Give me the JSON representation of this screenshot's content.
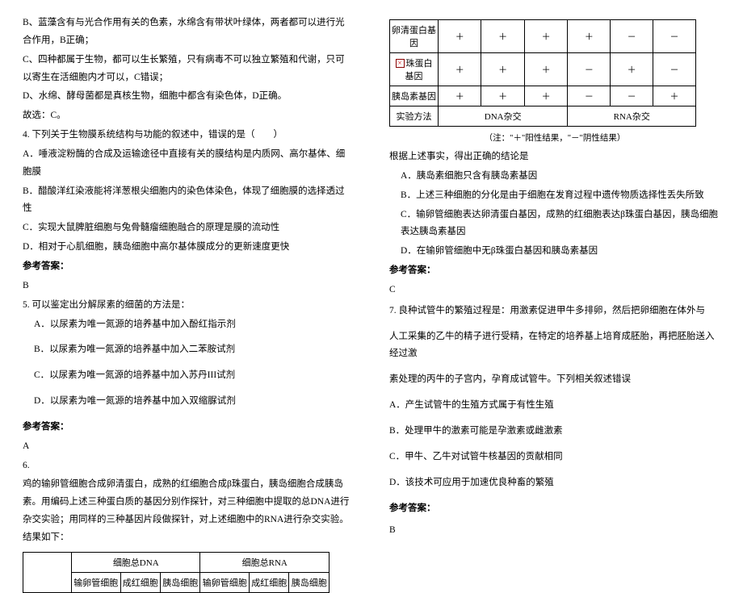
{
  "col1": {
    "p1": "B、蓝藻含有与光合作用有关的色素，水绵含有带状叶绿体，两者都可以进行光合作用，B正确；",
    "p2": "C、四种都属于生物，都可以生长繁殖，只有病毒不可以独立繁殖和代谢，只可以寄生在活细胞内才可以，C错误；",
    "p3": "D、水绵、酵母菌都是真核生物，细胞中都含有染色体，D正确。",
    "p4": "故选：C。",
    "q4": "4. 下列关于生物膜系统结构与功能的叙述中，错误的是（　　）",
    "q4a": "A．唾液淀粉酶的合成及运输途径中直接有关的膜结构是内质网、高尔基体、细胞膜",
    "q4b": "B．醋酸洋红染液能将洋葱根尖细胞内的染色体染色，体现了细胞膜的选择透过性",
    "q4c": "C．实现大鼠脾脏细胞与兔骨髓瘤细胞融合的原理是膜的流动性",
    "q4d": "D．相对于心肌细胞，胰岛细胞中高尔基体膜成分的更新速度更快",
    "ans4_label": "参考答案：",
    "ans4": "B",
    "q5": "5. 可以鉴定出分解尿素的细菌的方法是：",
    "q5a": "A．以尿素为唯一氮源的培养基中加入酚红指示剂",
    "q5b": "B．以尿素为唯一氮源的培养基中加入二苯胺试剂",
    "q5c": "C．以尿素为唯一氮源的培养基中加入苏丹III试剂",
    "q5d": "D．以尿素为唯一氮源的培养基中加入双缩脲试剂",
    "ans5_label": "参考答案：",
    "ans5": "A",
    "q6": "6.",
    "q6_p1": "鸡的输卵管细胞合成卵清蛋白，成熟的红细胞合成β珠蛋白，胰岛细胞合成胰岛素。用编码上述三种蛋白质的基因分别作探针，对三种细胞中提取的总DNA进行杂交实验；用同样的三种基因片段做探针，对上述细胞中的RNA进行杂交实验。结果如下：",
    "t1_h1": "细胞总DNA",
    "t1_h2": "细胞总RNA",
    "t1_c1": "输卵管细胞",
    "t1_c2": "成红细胞",
    "t1_c3": "胰岛细胞",
    "t1_c4": "输卵管细胞",
    "t1_c5": "成红细胞",
    "t1_c6": "胰岛细胞"
  },
  "col2": {
    "t2_r1": "卵清蛋白基因",
    "t2_r2": "珠蛋白基因",
    "t2_r3": "胰岛素基因",
    "t2_r4": "实验方法",
    "t2_m1": "DNA杂交",
    "t2_m2": "RNA杂交",
    "plus": "＋",
    "minus": "－",
    "note": "（注：\"＋\"阳性结果，\"－\"阴性结果）",
    "p_intro": "根据上述事实，得出正确的结论是",
    "a": "A．胰岛素细胞只含有胰岛素基因",
    "b": "B．上述三种细胞的分化是由于细胞在发育过程中遗传物质选择性丢失所致",
    "c": "C．输卵管细胞表达卵清蛋白基因，成熟的红细胞表达β珠蛋白基因，胰岛细胞表达胰岛素基因",
    "d": "D．在输卵管细胞中无β珠蛋白基因和胰岛素基因",
    "ans6_label": "参考答案：",
    "ans6": "C",
    "q7_p1": "7. 良种试管牛的繁殖过程是：用激素促进甲牛多排卵，然后把卵细胞在体外与",
    "q7_p2": "人工采集的乙牛的精子进行受精，在特定的培养基上培育成胚胎，再把胚胎送入经过激",
    "q7_p3": "素处理的丙牛的子宫内，孕育成试管牛。下列相关叙述错误",
    "q7a": "A．产生试管牛的生殖方式属于有性生殖",
    "q7b": "B．处理甲牛的激素可能是孕激素或雌激素",
    "q7c": "C．甲牛、乙牛对试管牛核基因的贡献相同",
    "q7d": "D．该技术可应用于加速优良种畜的繁殖",
    "ans7_label": "参考答案：",
    "ans7": "B"
  }
}
